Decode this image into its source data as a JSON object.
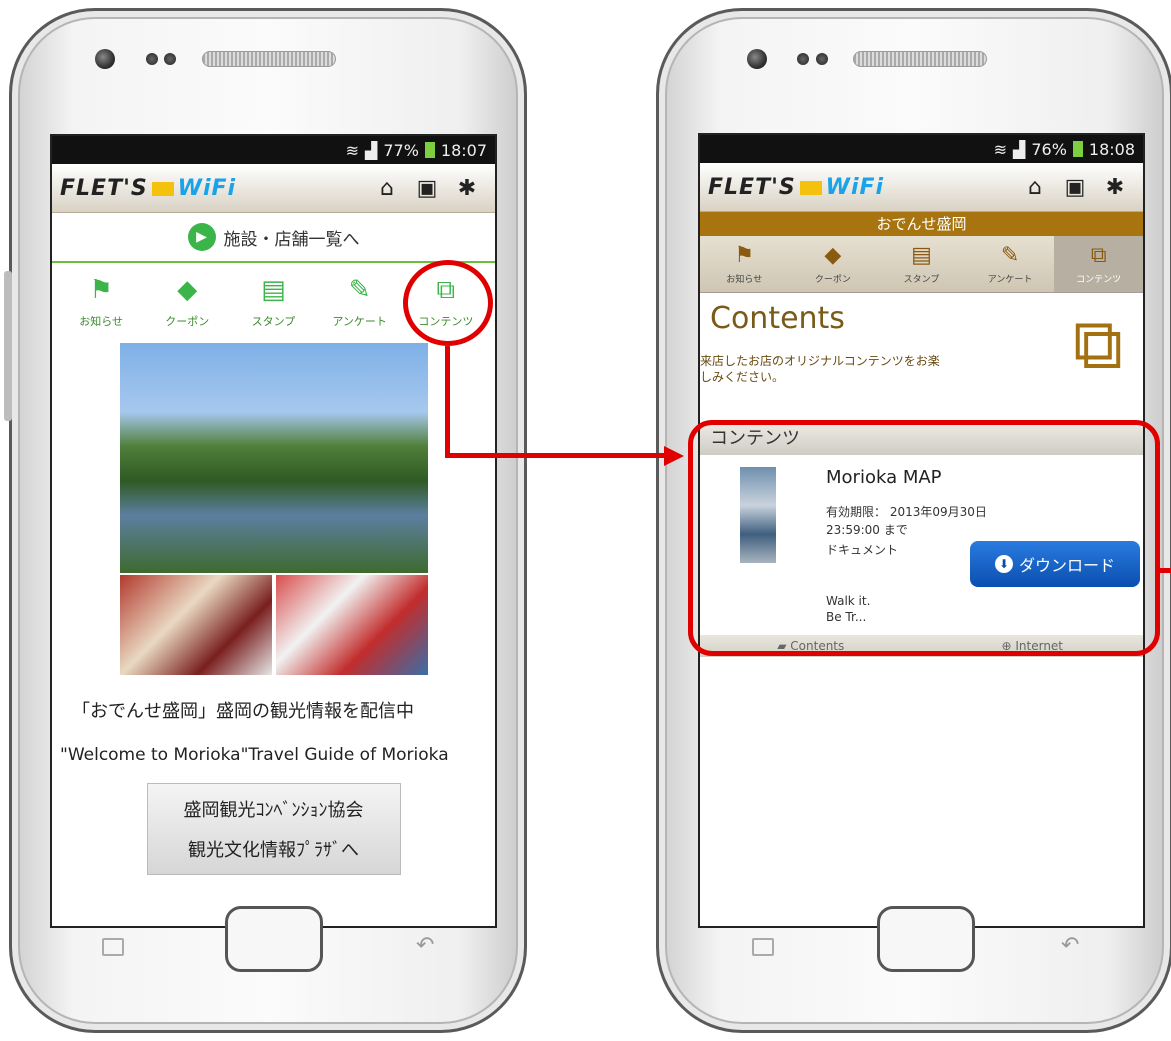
{
  "left_screen": {
    "status": {
      "battery": "77%",
      "time": "18:07"
    },
    "logo": {
      "flets": "FLET'S",
      "wifi": "WiFi"
    },
    "toolbar_icons": [
      "home-icon",
      "tray-icon",
      "gear-icon"
    ],
    "link": "施設・店舗一覧へ",
    "tabs": [
      {
        "label": "お知らせ",
        "icon": "flag-icon"
      },
      {
        "label": "クーポン",
        "icon": "tag-icon"
      },
      {
        "label": "スタンプ",
        "icon": "stamp-icon"
      },
      {
        "label": "アンケート",
        "icon": "pencil-icon"
      },
      {
        "label": "コンテンツ",
        "icon": "film-icon"
      }
    ],
    "caption_jp": "「おでんせ盛岡」盛岡の観光情報を配信中",
    "caption_en": "\"Welcome to Morioka\"Travel Guide of Morioka",
    "button_line1": "盛岡観光ｺﾝﾍﾞﾝｼｮﾝ協会",
    "button_line2": "観光文化情報ﾌﾟﾗｻﾞへ"
  },
  "right_screen": {
    "status": {
      "battery": "76%",
      "time": "18:08"
    },
    "venue": "おでんせ盛岡",
    "tabs": [
      "お知らせ",
      "クーポン",
      "スタンプ",
      "アンケート",
      "コンテンツ"
    ],
    "contents_title": "Contents",
    "contents_desc": "来店したお店のオリジナルコンテンツをお楽しみください。",
    "section": "コンテンツ",
    "item": {
      "title": "Morioka MAP",
      "expiry_label": "有効期限：",
      "expiry_date": "2013年09月30日",
      "expiry_time": "23:59:00 まで",
      "type": "ドキュメント",
      "download": "ダウンロード",
      "desc_line1": "Walk it.",
      "desc_line2": "Be Tr..."
    },
    "bottom_tabs": [
      "Contents",
      "Internet"
    ]
  },
  "colors": {
    "accent_green": "#3bb54a",
    "accent_gold": "#a7740f",
    "highlight_red": "#e00000",
    "download_blue": "#0a4fb0"
  }
}
